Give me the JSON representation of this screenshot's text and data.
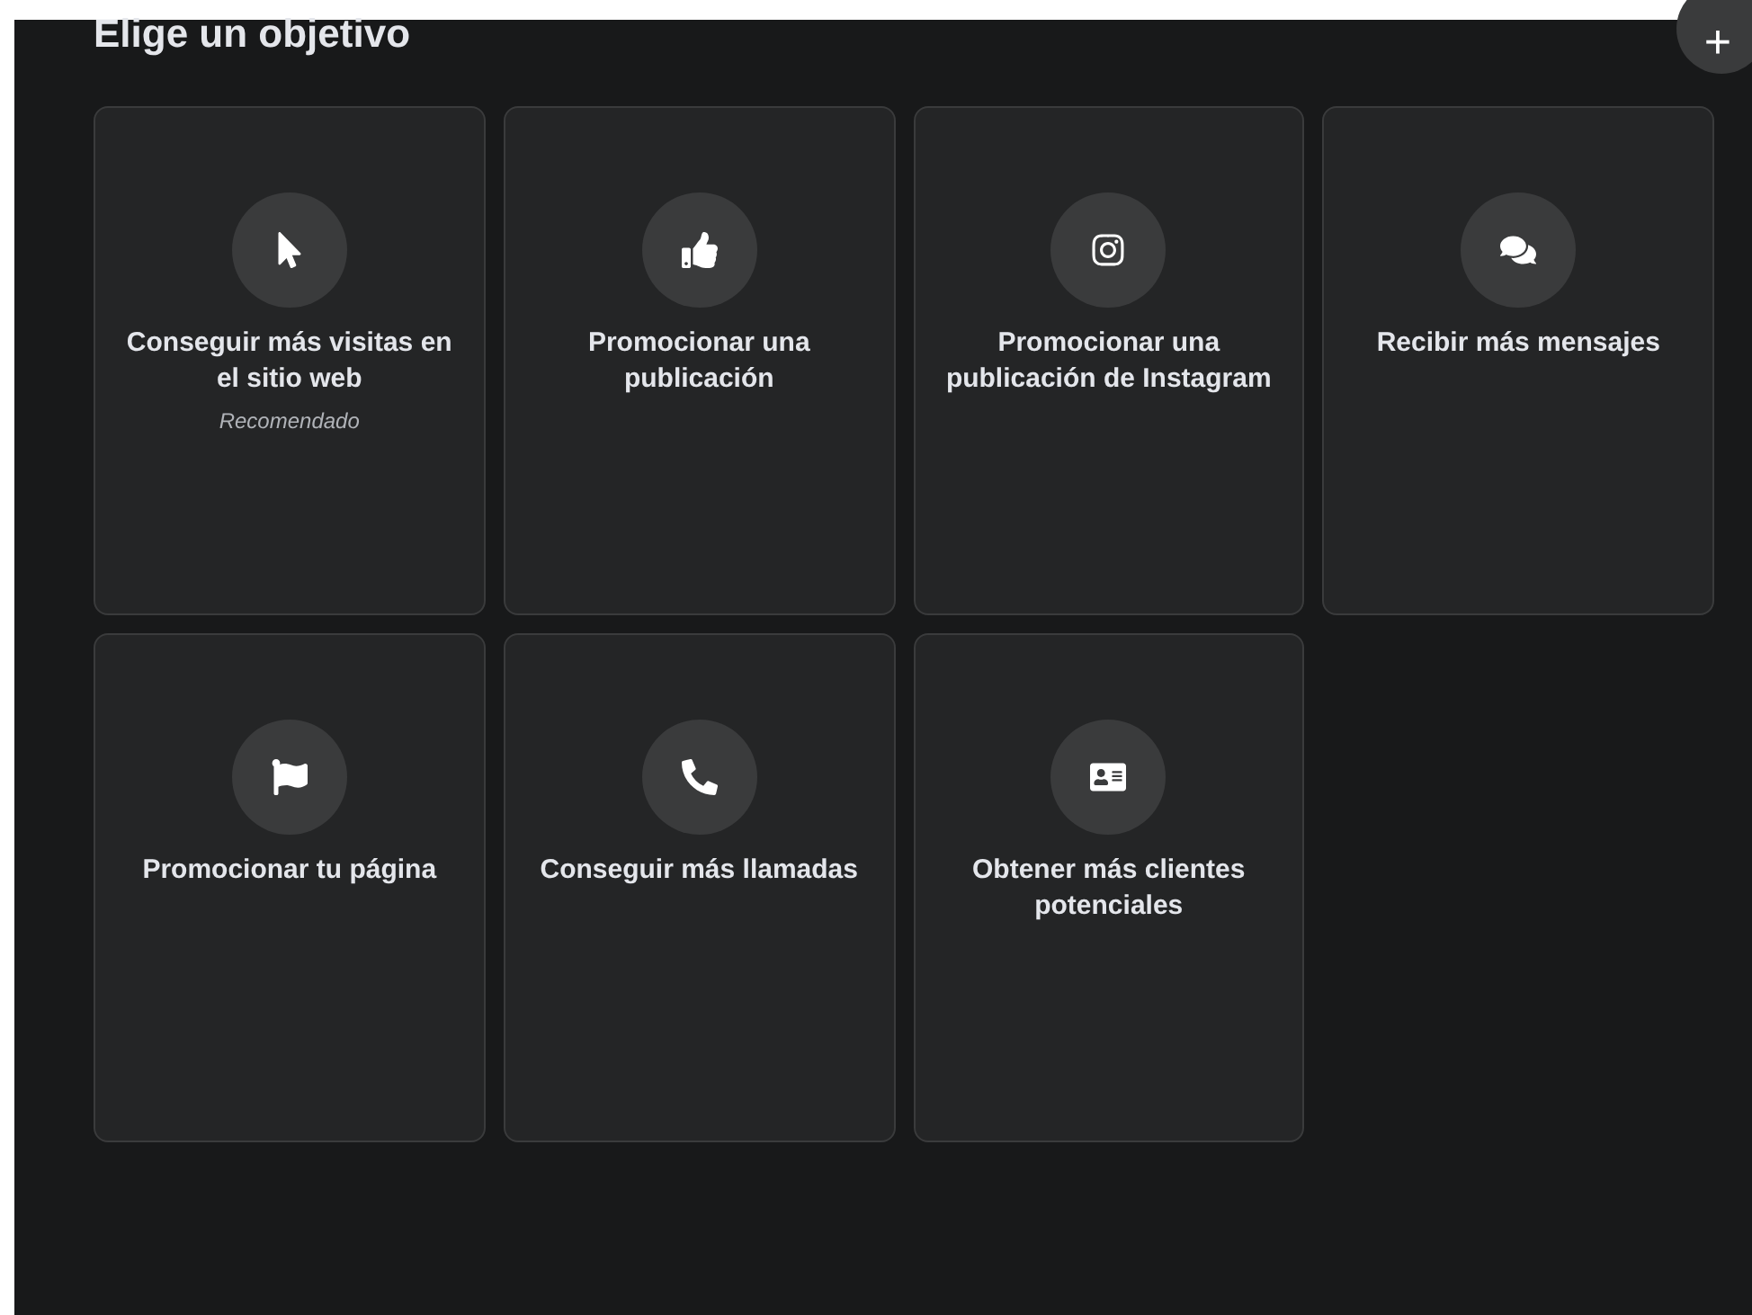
{
  "title": "Elige un objetivo",
  "add_button": {
    "label": "+"
  },
  "objectives": [
    {
      "label": "Conseguir más visitas en el sitio web",
      "note": "Recomendado"
    },
    {
      "label": "Promocionar una publicación"
    },
    {
      "label": "Promocionar una publicación de Instagram"
    },
    {
      "label": "Recibir más mensajes"
    },
    {
      "label": "Promocionar tu página"
    },
    {
      "label": "Conseguir más llamadas"
    },
    {
      "label": "Obtener más clientes potenciales"
    }
  ]
}
